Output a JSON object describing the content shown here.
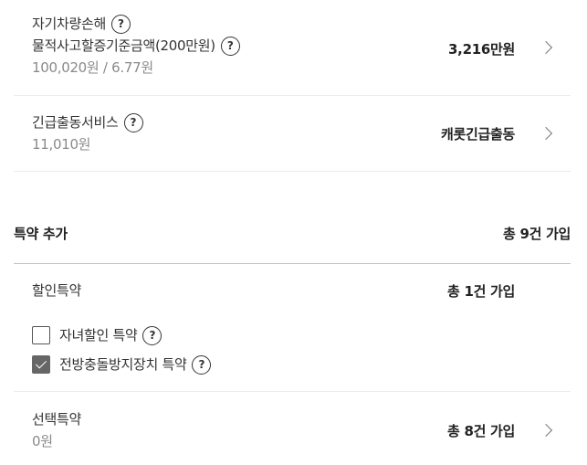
{
  "own_damage": {
    "title": "자기차량손해",
    "deductible_label": "물적사고할증기준금액(200만원)",
    "premium": "100,020원 / 6.77원",
    "value": "3,216만원"
  },
  "emergency": {
    "title": "긴급출동서비스",
    "premium": "11,010원",
    "value": "캐롯긴급출동"
  },
  "rider_section": {
    "title": "특약 추가",
    "total": "총 9건 가입"
  },
  "discount_riders": {
    "title": "할인특약",
    "total": "총 1건 가입",
    "items": [
      {
        "label": "자녀할인 특약",
        "checked": false
      },
      {
        "label": "전방충돌방지장치 특약",
        "checked": true
      }
    ]
  },
  "optional_riders": {
    "title": "선택특약",
    "premium": "0원",
    "total": "총 8건 가입"
  },
  "help_glyph": "?"
}
